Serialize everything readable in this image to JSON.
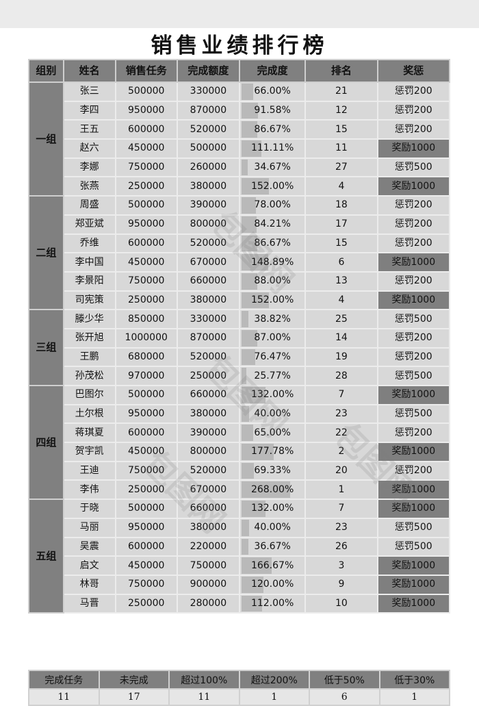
{
  "title": "销售业绩排行榜",
  "headers": [
    "组别",
    "姓名",
    "销售任务",
    "完成额度",
    "完成度",
    "排名",
    "奖惩"
  ],
  "bar_max_percent": 268.0,
  "colors": {
    "header": "#808080",
    "cell": "#d8d8d8",
    "bar": "#b9b9b9",
    "reward": "#7f7f7f"
  },
  "groups": [
    {
      "name": "一组",
      "rows": [
        {
          "name": "张三",
          "target": "500000",
          "done": "330000",
          "pct": "66.00%",
          "pct_value": 66.0,
          "rank": "21",
          "result": "惩罚200",
          "is_reward": false
        },
        {
          "name": "李四",
          "target": "950000",
          "done": "870000",
          "pct": "91.58%",
          "pct_value": 91.58,
          "rank": "12",
          "result": "惩罚200",
          "is_reward": false
        },
        {
          "name": "王五",
          "target": "600000",
          "done": "520000",
          "pct": "86.67%",
          "pct_value": 86.67,
          "rank": "15",
          "result": "惩罚200",
          "is_reward": false
        },
        {
          "name": "赵六",
          "target": "450000",
          "done": "500000",
          "pct": "111.11%",
          "pct_value": 111.11,
          "rank": "11",
          "result": "奖励1000",
          "is_reward": true
        },
        {
          "name": "李娜",
          "target": "750000",
          "done": "260000",
          "pct": "34.67%",
          "pct_value": 34.67,
          "rank": "27",
          "result": "惩罚500",
          "is_reward": false
        },
        {
          "name": "张燕",
          "target": "250000",
          "done": "380000",
          "pct": "152.00%",
          "pct_value": 152.0,
          "rank": "4",
          "result": "奖励1000",
          "is_reward": true
        }
      ]
    },
    {
      "name": "二组",
      "rows": [
        {
          "name": "周盛",
          "target": "500000",
          "done": "390000",
          "pct": "78.00%",
          "pct_value": 78.0,
          "rank": "18",
          "result": "惩罚200",
          "is_reward": false
        },
        {
          "name": "郑亚斌",
          "target": "950000",
          "done": "800000",
          "pct": "84.21%",
          "pct_value": 84.21,
          "rank": "17",
          "result": "惩罚200",
          "is_reward": false
        },
        {
          "name": "乔维",
          "target": "600000",
          "done": "520000",
          "pct": "86.67%",
          "pct_value": 86.67,
          "rank": "15",
          "result": "惩罚200",
          "is_reward": false
        },
        {
          "name": "李中国",
          "target": "450000",
          "done": "670000",
          "pct": "148.89%",
          "pct_value": 148.89,
          "rank": "6",
          "result": "奖励1000",
          "is_reward": true
        },
        {
          "name": "李景阳",
          "target": "750000",
          "done": "660000",
          "pct": "88.00%",
          "pct_value": 88.0,
          "rank": "13",
          "result": "惩罚200",
          "is_reward": false
        },
        {
          "name": "司宪策",
          "target": "250000",
          "done": "380000",
          "pct": "152.00%",
          "pct_value": 152.0,
          "rank": "4",
          "result": "奖励1000",
          "is_reward": true
        }
      ]
    },
    {
      "name": "三组",
      "rows": [
        {
          "name": "滕少华",
          "target": "850000",
          "done": "330000",
          "pct": "38.82%",
          "pct_value": 38.82,
          "rank": "25",
          "result": "惩罚500",
          "is_reward": false
        },
        {
          "name": "张开旭",
          "target": "1000000",
          "done": "870000",
          "pct": "87.00%",
          "pct_value": 87.0,
          "rank": "14",
          "result": "惩罚200",
          "is_reward": false
        },
        {
          "name": "王鹏",
          "target": "680000",
          "done": "520000",
          "pct": "76.47%",
          "pct_value": 76.47,
          "rank": "19",
          "result": "惩罚200",
          "is_reward": false
        },
        {
          "name": "孙茂松",
          "target": "970000",
          "done": "250000",
          "pct": "25.77%",
          "pct_value": 25.77,
          "rank": "28",
          "result": "惩罚500",
          "is_reward": false
        }
      ]
    },
    {
      "name": "四组",
      "rows": [
        {
          "name": "巴图尔",
          "target": "500000",
          "done": "660000",
          "pct": "132.00%",
          "pct_value": 132.0,
          "rank": "7",
          "result": "奖励1000",
          "is_reward": true
        },
        {
          "name": "土尔根",
          "target": "950000",
          "done": "380000",
          "pct": "40.00%",
          "pct_value": 40.0,
          "rank": "23",
          "result": "惩罚500",
          "is_reward": false
        },
        {
          "name": "蒋琪夏",
          "target": "600000",
          "done": "390000",
          "pct": "65.00%",
          "pct_value": 65.0,
          "rank": "22",
          "result": "惩罚200",
          "is_reward": false
        },
        {
          "name": "贺宇凯",
          "target": "450000",
          "done": "800000",
          "pct": "177.78%",
          "pct_value": 177.78,
          "rank": "2",
          "result": "奖励1000",
          "is_reward": true
        },
        {
          "name": "王迪",
          "target": "750000",
          "done": "520000",
          "pct": "69.33%",
          "pct_value": 69.33,
          "rank": "20",
          "result": "惩罚200",
          "is_reward": false
        },
        {
          "name": "李伟",
          "target": "250000",
          "done": "670000",
          "pct": "268.00%",
          "pct_value": 268.0,
          "rank": "1",
          "result": "奖励1000",
          "is_reward": true
        }
      ]
    },
    {
      "name": "五组",
      "rows": [
        {
          "name": "于晓",
          "target": "500000",
          "done": "660000",
          "pct": "132.00%",
          "pct_value": 132.0,
          "rank": "7",
          "result": "奖励1000",
          "is_reward": true
        },
        {
          "name": "马丽",
          "target": "950000",
          "done": "380000",
          "pct": "40.00%",
          "pct_value": 40.0,
          "rank": "23",
          "result": "惩罚500",
          "is_reward": false
        },
        {
          "name": "吴震",
          "target": "600000",
          "done": "220000",
          "pct": "36.67%",
          "pct_value": 36.67,
          "rank": "26",
          "result": "惩罚500",
          "is_reward": false
        },
        {
          "name": "启文",
          "target": "450000",
          "done": "750000",
          "pct": "166.67%",
          "pct_value": 166.67,
          "rank": "3",
          "result": "奖励1000",
          "is_reward": true
        },
        {
          "name": "林哥",
          "target": "750000",
          "done": "900000",
          "pct": "120.00%",
          "pct_value": 120.0,
          "rank": "9",
          "result": "奖励1000",
          "is_reward": true
        },
        {
          "name": "马晋",
          "target": "250000",
          "done": "280000",
          "pct": "112.00%",
          "pct_value": 112.0,
          "rank": "10",
          "result": "奖励1000",
          "is_reward": true
        }
      ]
    }
  ],
  "summary": {
    "headers": [
      "完成任务",
      "未完成",
      "超过100%",
      "超过200%",
      "低于50%",
      "低于30%"
    ],
    "values": [
      "11",
      "17",
      "11",
      "1",
      "6",
      "1"
    ]
  },
  "watermark": "包图网"
}
